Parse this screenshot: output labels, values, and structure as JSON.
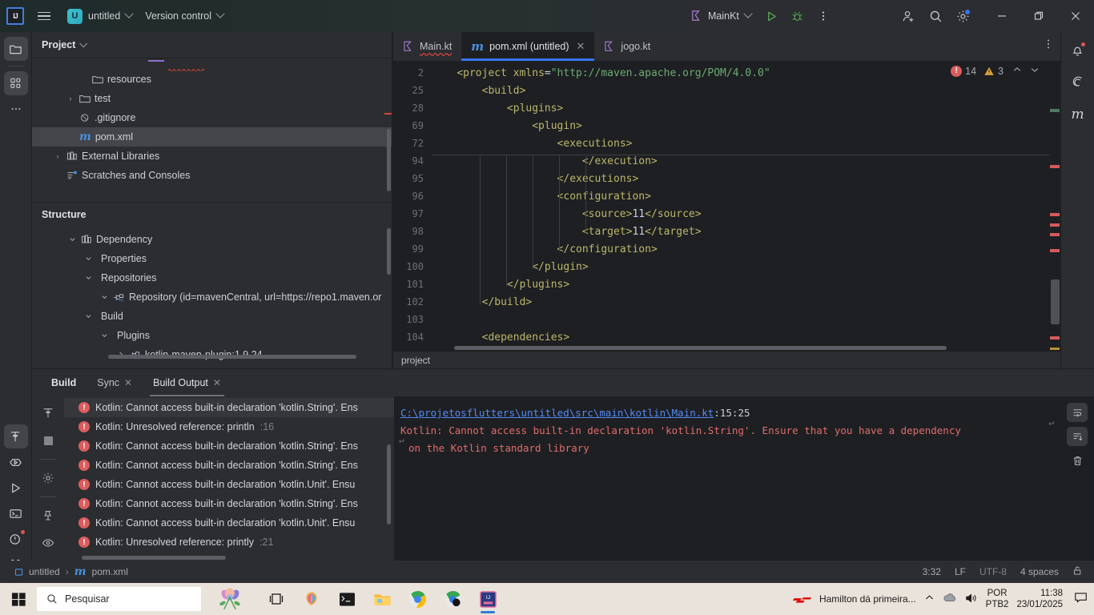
{
  "titlebar": {
    "logo": "ij-logo",
    "menu_icon": "hamburger-menu-icon",
    "project_badge": "U",
    "project_name": "untitled",
    "version_control": "Version control",
    "run_config": "MainKt",
    "icons": {
      "run": "run-icon",
      "debug": "debug-icon",
      "more": "more-options-icon",
      "share": "add-user-icon",
      "search": "search-icon",
      "settings": "settings-gear-icon",
      "minimize": "minimize-icon",
      "maximize": "maximize-icon",
      "close": "close-icon"
    }
  },
  "left_toolbar": {
    "top_items": [
      {
        "name": "project-tool-icon",
        "label": "Project"
      },
      {
        "name": "structure-tool-icon",
        "label": "Structure"
      },
      {
        "name": "more-tool-windows-icon",
        "label": "More"
      }
    ],
    "bottom_items": [
      {
        "name": "build-tool-icon",
        "label": "Build"
      },
      {
        "name": "services-tool-icon",
        "label": "Services"
      },
      {
        "name": "run-tool-icon",
        "label": "Run"
      },
      {
        "name": "terminal-tool-icon",
        "label": "Terminal"
      },
      {
        "name": "problems-tool-icon",
        "label": "Problems"
      },
      {
        "name": "version-control-tool-icon",
        "label": "Version Control"
      }
    ]
  },
  "right_toolbar": {
    "items": [
      {
        "name": "notifications-icon",
        "label": "Notifications"
      },
      {
        "name": "ai-assistant-icon",
        "label": "AI Assistant"
      },
      {
        "name": "maven-tool-icon",
        "label": "Maven"
      }
    ]
  },
  "project_panel": {
    "title": "Project",
    "tree": [
      {
        "indent": 3,
        "arrow": "",
        "icon": "folder-icon",
        "label": "resources",
        "selected": false
      },
      {
        "indent": 2,
        "arrow": "›",
        "icon": "folder-icon",
        "label": "test",
        "selected": false
      },
      {
        "indent": 2,
        "arrow": "",
        "icon": "gitignore-icon",
        "label": ".gitignore",
        "selected": false
      },
      {
        "indent": 2,
        "arrow": "",
        "icon": "maven-icon",
        "label": "pom.xml",
        "selected": true
      },
      {
        "indent": 1,
        "arrow": "›",
        "icon": "library-icon",
        "label": "External Libraries",
        "selected": false
      },
      {
        "indent": 1,
        "arrow": "",
        "icon": "scratches-icon",
        "label": "Scratches and Consoles",
        "selected": false
      }
    ]
  },
  "structure_panel": {
    "title": "Structure",
    "tree": [
      {
        "indent": 1,
        "arrow": "⌄",
        "icon": "dependency-icon",
        "label": "Dependency"
      },
      {
        "indent": 2,
        "arrow": "⌄",
        "icon": "",
        "label": "Properties"
      },
      {
        "indent": 2,
        "arrow": "⌄",
        "icon": "",
        "label": "Repositories"
      },
      {
        "indent": 3,
        "arrow": "⌄",
        "icon": "maven-node-icon",
        "label": "Repository (id=mavenCentral, url=https://repo1.maven.or"
      },
      {
        "indent": 2,
        "arrow": "⌄",
        "icon": "",
        "label": "Build"
      },
      {
        "indent": 3,
        "arrow": "⌄",
        "icon": "",
        "label": "Plugins"
      },
      {
        "indent": 4,
        "arrow": "›",
        "icon": "maven-node-icon",
        "label": "kotlin-maven-plugin:1.9.24"
      }
    ]
  },
  "editor": {
    "tabs": [
      {
        "label": "Main.kt",
        "icon": "kotlin-file-icon",
        "active": false,
        "closable": false,
        "error": true
      },
      {
        "label": "pom.xml (untitled)",
        "icon": "maven-file-icon",
        "active": true,
        "closable": true,
        "error": false
      },
      {
        "label": "jogo.kt",
        "icon": "kotlin-file-icon",
        "active": false,
        "closable": false,
        "error": false
      }
    ],
    "tab_menu_icon": "tab-options-icon",
    "error_count": "14",
    "warning_count": "3",
    "nav_up_icon": "prev-problem-icon",
    "nav_down_icon": "next-problem-icon",
    "breadcrumb": "project",
    "lines": [
      {
        "num": "2",
        "indent": 2,
        "html": "<span class='c-tag'>&lt;project</span> <span class='c-attr'>xmlns</span>=<span class='c-str'>\"http://maven.apache.org/POM/4.0.0\"</span>"
      },
      {
        "num": "25",
        "indent": 4,
        "html": "<span class='c-tag'>&lt;build&gt;</span>"
      },
      {
        "num": "28",
        "indent": 6,
        "html": "<span class='c-tag'>&lt;plugins&gt;</span>"
      },
      {
        "num": "69",
        "indent": 8,
        "html": "<span class='c-tag'>&lt;plugin&gt;</span>"
      },
      {
        "num": "72",
        "indent": 10,
        "html": "<span class='c-tag'>&lt;executions&gt;</span>"
      },
      {
        "num": "94",
        "indent": 12,
        "html": "<span class='c-tag'>&lt;/execution&gt;</span>"
      },
      {
        "num": "95",
        "indent": 10,
        "html": "<span class='c-tag'>&lt;/executions&gt;</span>"
      },
      {
        "num": "96",
        "indent": 10,
        "html": "<span class='c-tag'>&lt;configuration&gt;</span>"
      },
      {
        "num": "97",
        "indent": 12,
        "html": "<span class='c-tag'>&lt;source&gt;</span><span class='c-val'>11</span><span class='c-tag'>&lt;/source&gt;</span>"
      },
      {
        "num": "98",
        "indent": 12,
        "html": "<span class='c-tag'>&lt;target&gt;</span><span class='c-val'>11</span><span class='c-tag'>&lt;/target&gt;</span>"
      },
      {
        "num": "99",
        "indent": 10,
        "html": "<span class='c-tag'>&lt;/configuration&gt;</span>"
      },
      {
        "num": "100",
        "indent": 8,
        "html": "<span class='c-tag'>&lt;/plugin&gt;</span>"
      },
      {
        "num": "101",
        "indent": 6,
        "html": "<span class='c-tag'>&lt;/plugins&gt;</span>"
      },
      {
        "num": "102",
        "indent": 4,
        "html": "<span class='c-tag'>&lt;/build&gt;</span>"
      },
      {
        "num": "103",
        "indent": 0,
        "html": ""
      },
      {
        "num": "104",
        "indent": 4,
        "html": "<span class='c-tag'>&lt;dependencies&gt;</span>"
      }
    ]
  },
  "build_panel": {
    "title": "Build",
    "tabs": [
      {
        "label": "Sync",
        "closable": true,
        "active": false
      },
      {
        "label": "Build Output",
        "closable": true,
        "active": true
      }
    ],
    "side_icons": [
      {
        "name": "build-hammer-icon"
      },
      {
        "name": "stop-icon"
      },
      {
        "name": "settings-gear-icon"
      },
      {
        "name": "pin-icon"
      },
      {
        "name": "eye-icon"
      }
    ],
    "errors": [
      {
        "text": "Kotlin: Cannot access built-in declaration 'kotlin.String'. Ens",
        "loc": "",
        "selected": true
      },
      {
        "text": "Kotlin: Unresolved reference: println",
        "loc": ":16",
        "selected": false
      },
      {
        "text": "Kotlin: Cannot access built-in declaration 'kotlin.String'. Ens",
        "loc": "",
        "selected": false
      },
      {
        "text": "Kotlin: Cannot access built-in declaration 'kotlin.String'. Ens",
        "loc": "",
        "selected": false
      },
      {
        "text": "Kotlin: Cannot access built-in declaration 'kotlin.Unit'. Ensu",
        "loc": "",
        "selected": false
      },
      {
        "text": "Kotlin: Cannot access built-in declaration 'kotlin.String'. Ens",
        "loc": "",
        "selected": false
      },
      {
        "text": "Kotlin: Cannot access built-in declaration 'kotlin.Unit'. Ensu",
        "loc": "",
        "selected": false
      },
      {
        "text": "Kotlin: Unresolved reference: printly",
        "loc": ":21",
        "selected": false
      }
    ],
    "detail": {
      "path": "C:\\projetosflutters\\untitled\\src\\main\\kotlin\\Main.kt",
      "position": ":15:25",
      "message_line1": "Kotlin: Cannot access built-in declaration 'kotlin.String'. Ensure that you have a dependency",
      "message_line2": "on the Kotlin standard library"
    },
    "detail_tools": [
      {
        "name": "soft-wrap-icon"
      },
      {
        "name": "scroll-to-end-icon"
      },
      {
        "name": "clear-all-icon"
      }
    ]
  },
  "statusbar": {
    "project": "untitled",
    "separator": "›",
    "file": "pom.xml",
    "caret": "3:32",
    "line_sep": "LF",
    "encoding": "UTF-8",
    "indent": "4 spaces",
    "lock_icon": "unlocked-icon"
  },
  "taskbar": {
    "start_icon": "windows-start-icon",
    "search_placeholder": "Pesquisar",
    "search_icon": "search-icon",
    "items": [
      {
        "name": "widgets-icon"
      },
      {
        "name": "task-view-icon"
      },
      {
        "name": "copilot-icon"
      },
      {
        "name": "terminal-icon"
      },
      {
        "name": "file-explorer-icon"
      },
      {
        "name": "chrome-icon"
      },
      {
        "name": "chrome-canary-icon"
      },
      {
        "name": "intellij-idea-icon"
      }
    ],
    "news": {
      "icon": "f1-logo-icon",
      "headline": "Hamilton dá primeira..."
    },
    "tray": {
      "expand_icon": "show-hidden-icons-icon",
      "cloud_icon": "onedrive-icon",
      "volume_icon": "volume-icon",
      "lang_line1": "POR",
      "lang_line2": "PTB2",
      "time": "11:38",
      "date": "23/01/2025",
      "notification_icon": "notification-center-icon"
    }
  },
  "colors": {
    "accent": "#3574f0",
    "error": "#db5c5c",
    "warning": "#d9a23b",
    "bg_dark": "#1e1f22",
    "bg_panel": "#2b2d30"
  }
}
